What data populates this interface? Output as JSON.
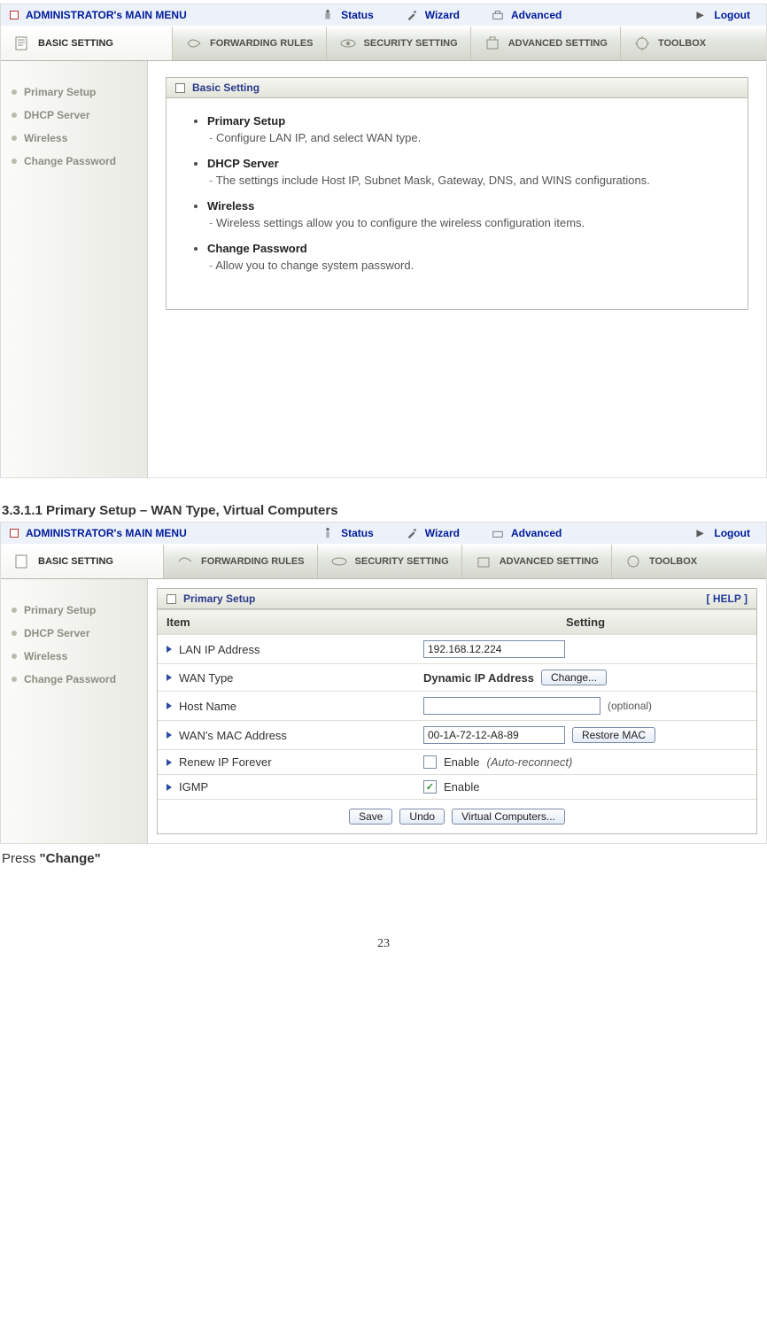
{
  "topmenu": {
    "title": "ADMINISTRATOR's MAIN MENU",
    "items": [
      "Status",
      "Wizard",
      "Advanced"
    ],
    "logout": "Logout"
  },
  "tabs": [
    "BASIC SETTING",
    "FORWARDING RULES",
    "SECURITY SETTING",
    "ADVANCED SETTING",
    "TOOLBOX"
  ],
  "sidebar": [
    "Primary Setup",
    "DHCP Server",
    "Wireless",
    "Change Password"
  ],
  "panel1": {
    "title": "Basic Setting",
    "items": [
      {
        "h": "Primary Setup",
        "d": "Configure LAN IP, and select WAN type."
      },
      {
        "h": "DHCP Server",
        "d": "The settings include Host IP, Subnet Mask, Gateway, DNS, and WINS configurations."
      },
      {
        "h": "Wireless",
        "d": "Wireless settings allow you to configure the wireless configuration items."
      },
      {
        "h": "Change Password",
        "d": "Allow you to change system password."
      }
    ]
  },
  "section_heading": "3.3.1.1 Primary Setup – WAN Type, Virtual Computers",
  "panel2": {
    "title": "Primary Setup",
    "help": "[ HELP ]",
    "col1": "Item",
    "col2": "Setting",
    "rows": {
      "lan_label": "LAN IP Address",
      "lan_value": "192.168.12.224",
      "wan_label": "WAN Type",
      "wan_value": "Dynamic IP Address",
      "wan_btn": "Change...",
      "host_label": "Host Name",
      "host_value": "",
      "host_opt": "(optional)",
      "mac_label": "WAN's MAC Address",
      "mac_value": "00-1A-72-12-A8-89",
      "mac_btn": "Restore MAC",
      "renew_label": "Renew IP Forever",
      "renew_chk": "Enable",
      "renew_note": "(Auto-reconnect)",
      "igmp_label": "IGMP",
      "igmp_chk": "Enable"
    },
    "footer": {
      "save": "Save",
      "undo": "Undo",
      "virtual": "Virtual Computers..."
    }
  },
  "press_line_pre": "Press ",
  "press_line_bold": "\"Change\"",
  "page_number": "23"
}
